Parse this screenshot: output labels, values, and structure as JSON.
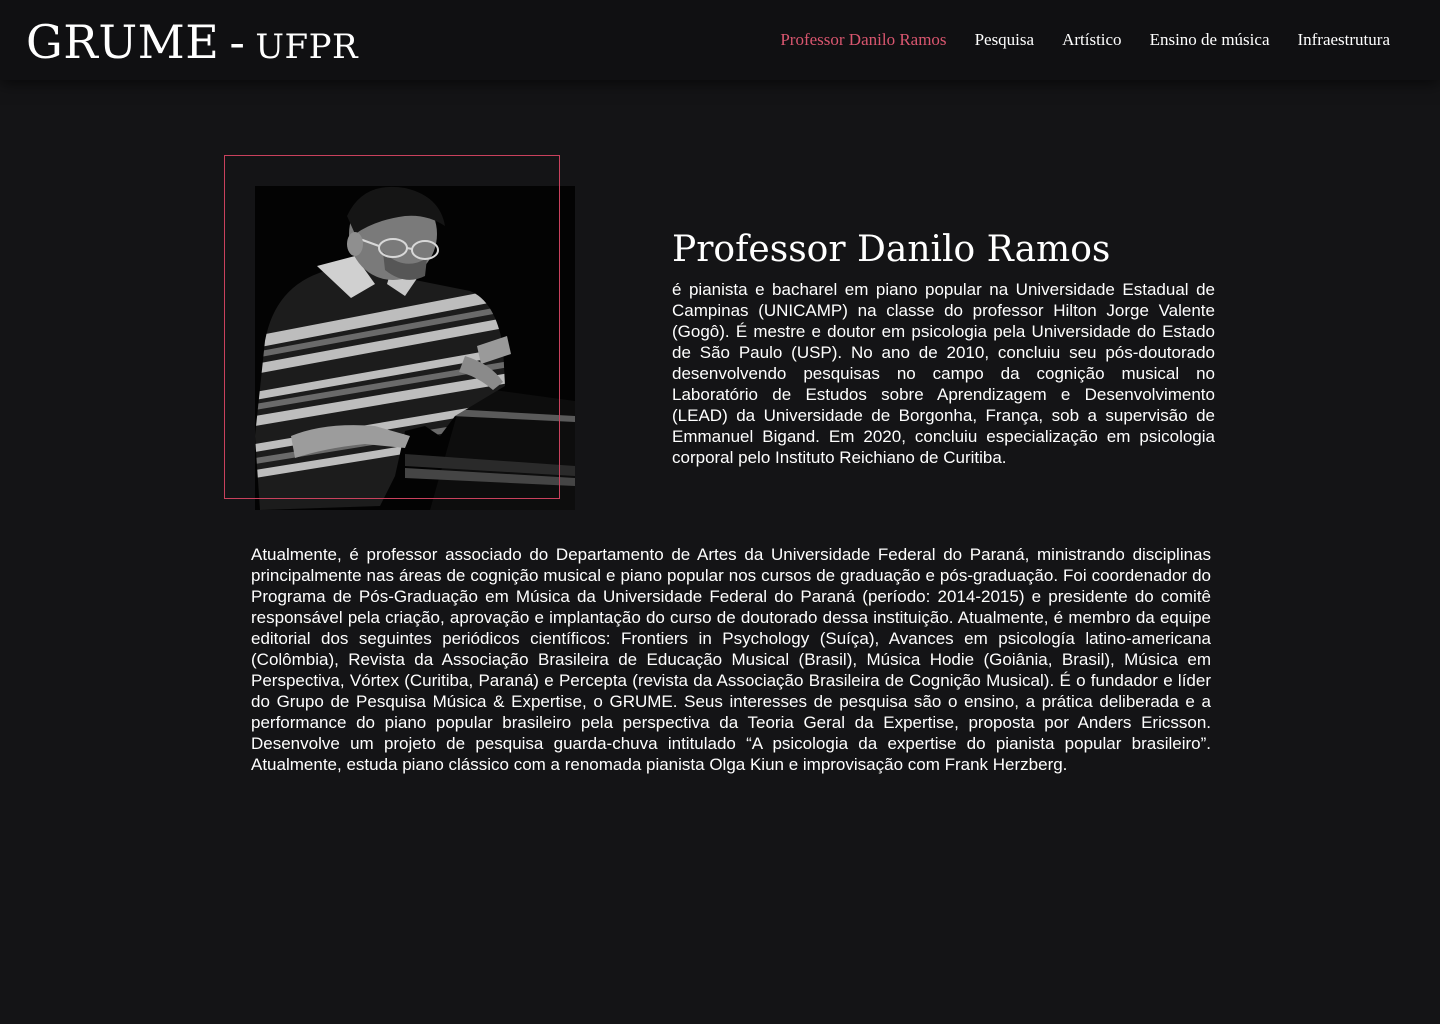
{
  "header": {
    "brand_main": "GRUME",
    "brand_sep": "-",
    "brand_sub": "UFPR"
  },
  "nav": {
    "items": [
      {
        "label": "Professor Danilo Ramos",
        "active": true
      },
      {
        "label": "Pesquisa",
        "active": false
      },
      {
        "label": "Artístico",
        "active": false
      },
      {
        "label": "Ensino de música",
        "active": false
      },
      {
        "label": "Infraestrutura",
        "active": false
      }
    ]
  },
  "colors": {
    "accent": "#d9566f",
    "frame": "#c9415d",
    "background": "#141416",
    "topbar": "#101012"
  },
  "profile": {
    "name": "Professor Danilo Ramos",
    "intro": "é pianista e bacharel em piano popular na Universidade Estadual de Campinas (UNICAMP) na classe do professor Hilton Jorge Valente (Gogô). É mestre e doutor em psicologia pela Universidade do Estado de São Paulo (USP). No ano de 2010, concluiu seu pós-doutorado desenvolvendo pesquisas no campo da cognição musical no Laboratório de Estudos sobre Aprendizagem e Desenvolvimento (LEAD) da Universidade de Borgonha, França, sob a supervisão de Emmanuel Bigand. Em 2020, concluiu especialização em psicologia corporal pelo Instituto Reichiano de Curitiba.",
    "main": "Atualmente, é professor associado do Departamento de Artes da Universidade Federal do Paraná, ministrando disciplinas principalmente nas áreas de cognição musical e piano popular nos cursos de graduação e pós-graduação. Foi coordenador do Programa de Pós-Graduação em Música da Universidade Federal do Paraná (período: 2014-2015) e presidente do comitê responsável pela criação, aprovação e implantação do curso de doutorado dessa instituição. Atualmente, é membro da equipe editorial dos seguintes periódicos científicos: Frontiers in Psychology (Suíça), Avances em psicología latino-americana (Colômbia), Revista da Associação Brasileira de Educação Musical (Brasil), Música Hodie (Goiânia, Brasil), Música em Perspectiva, Vórtex (Curitiba, Paraná) e Percepta (revista da Associação Brasileira de Cognição Musical). É o fundador e líder do Grupo de Pesquisa Música & Expertise, o GRUME. Seus interesses de pesquisa são o ensino, a prática deliberada e a performance do piano popular brasileiro pela perspectiva da Teoria Geral da Expertise, proposta por Anders Ericsson. Desenvolve um projeto de pesquisa guarda-chuva intitulado “A psicologia da expertise do pianista popular brasileiro”. Atualmente, estuda piano clássico com a renomada pianista Olga Kiun e improvisação com Frank Herzberg."
  }
}
